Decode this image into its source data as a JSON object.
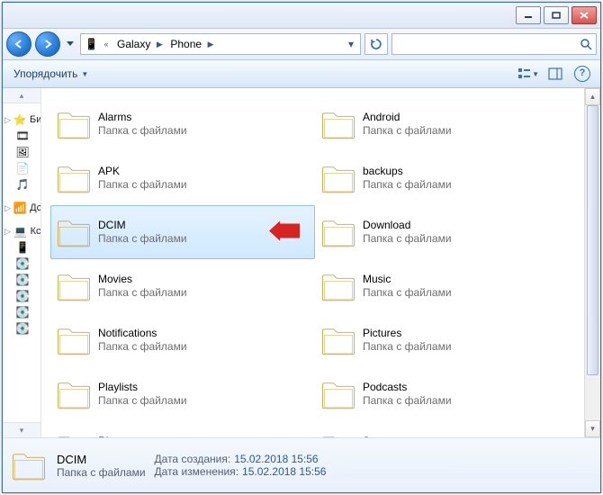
{
  "colors": {
    "selection": "#cfe8ff",
    "link": "#2857a5",
    "arrow": "#d8231f"
  },
  "nav": {
    "back_enabled": true,
    "forward_enabled": true,
    "breadcrumb": {
      "root_chevrons": "«",
      "seg1": "Galaxy",
      "seg2": "Phone"
    }
  },
  "toolbar": {
    "organize_label": "Упорядочить"
  },
  "sidebar": {
    "groups": [
      {
        "tri": "▷",
        "label": "Би"
      },
      {
        "tri": "▷",
        "label": "Дс"
      },
      {
        "tri": "▷",
        "label": "Кс"
      }
    ],
    "mini_icons": [
      "video",
      "picture",
      "doc",
      "music"
    ],
    "drive_count": 5
  },
  "folder_type_label": "Папка с файлами",
  "folders": [
    {
      "name": "Alarms"
    },
    {
      "name": "Android"
    },
    {
      "name": "APK"
    },
    {
      "name": "backups"
    },
    {
      "name": "DCIM",
      "selected": true,
      "pointer": true
    },
    {
      "name": "Download"
    },
    {
      "name": "Movies"
    },
    {
      "name": "Music"
    },
    {
      "name": "Notifications"
    },
    {
      "name": "Pictures"
    },
    {
      "name": "Playlists"
    },
    {
      "name": "Podcasts"
    },
    {
      "name": "Ringtones"
    },
    {
      "name": "Samsung"
    }
  ],
  "details": {
    "name": "DCIM",
    "type": "Папка с файлами",
    "created_label": "Дата создания:",
    "created_value": "15.02.2018 15:56",
    "modified_label": "Дата изменения:",
    "modified_value": "15.02.2018 15:56"
  }
}
